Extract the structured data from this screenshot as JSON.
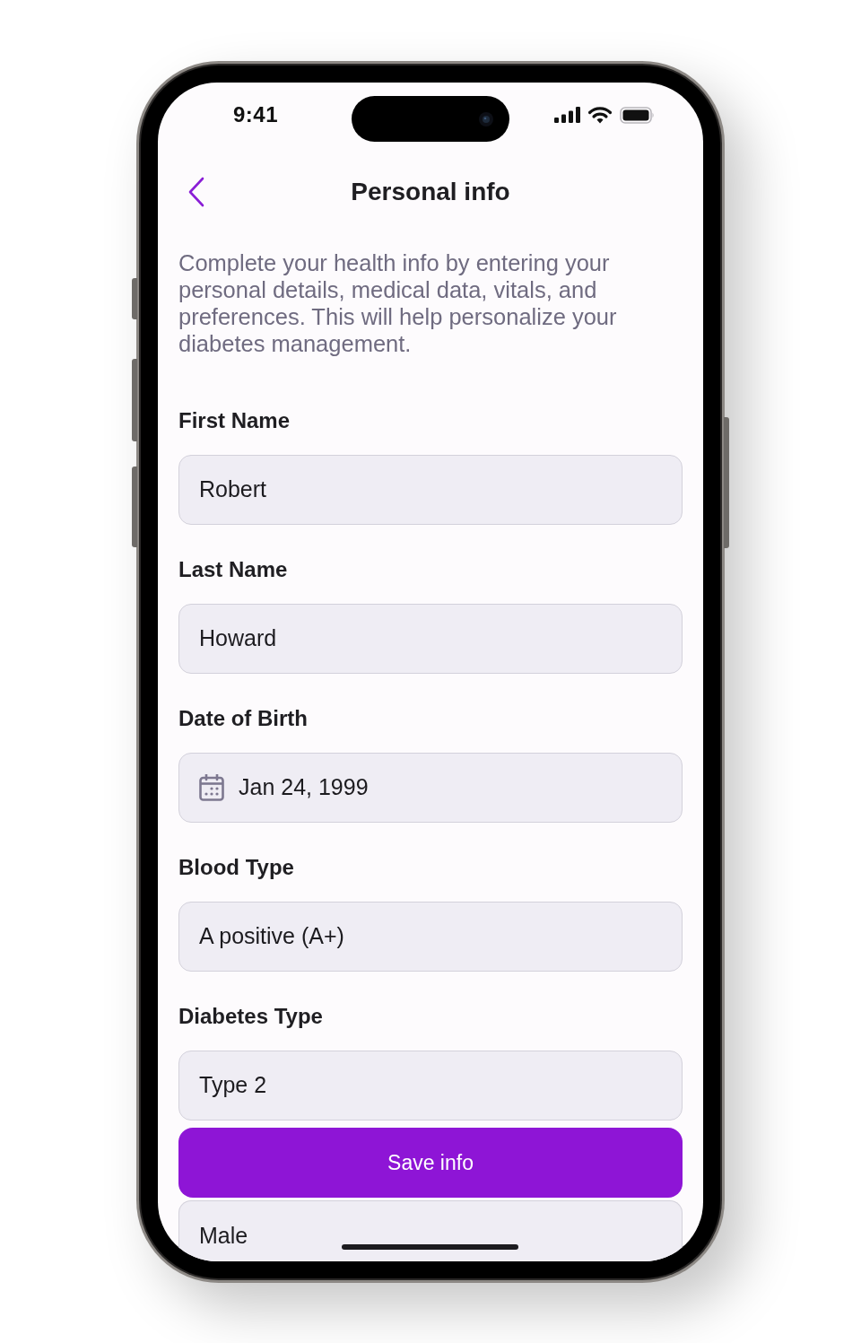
{
  "status_bar": {
    "time": "9:41"
  },
  "header": {
    "title": "Personal info"
  },
  "intro": "Complete your health info by entering your personal details, medical data, vitals, and preferences. This will help personalize your diabetes management.",
  "fields": [
    {
      "label": "First Name",
      "value": "Robert",
      "kind": "text"
    },
    {
      "label": "Last Name",
      "value": "Howard",
      "kind": "text"
    },
    {
      "label": "Date of Birth",
      "value": "Jan 24, 1999",
      "kind": "date"
    },
    {
      "label": "Blood Type",
      "value": "A positive (A+)",
      "kind": "text"
    },
    {
      "label": "Diabetes Type",
      "value": "Type 2",
      "kind": "text"
    }
  ],
  "save_button": {
    "label": "Save info"
  },
  "partly_hidden_field": {
    "value": "Male"
  }
}
